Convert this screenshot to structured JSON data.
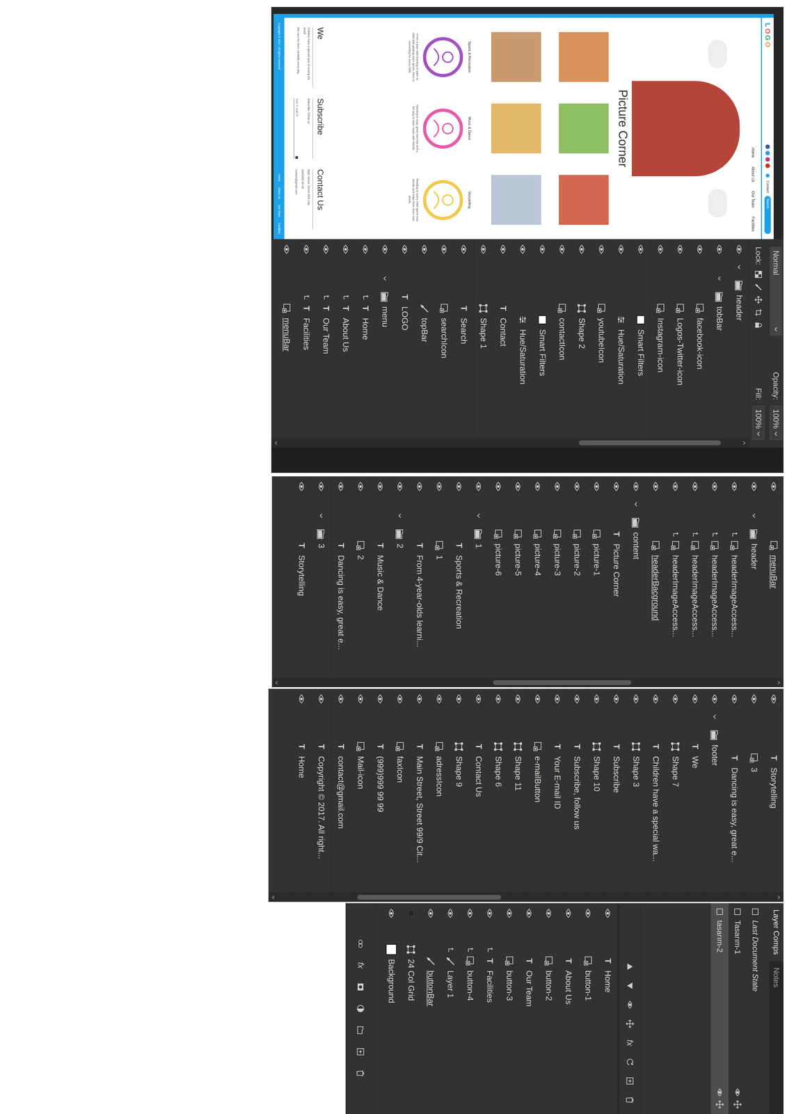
{
  "mockup": {
    "logo": [
      {
        "char": "L",
        "color": "#2d9cdb"
      },
      {
        "char": "O",
        "color": "#eb5757"
      },
      {
        "char": "G",
        "color": "#27ae60"
      },
      {
        "char": "O",
        "color": "#f2994a"
      }
    ],
    "contact": "Contact",
    "search": "Search",
    "nav": [
      "Home",
      "About Us",
      "Our Team",
      "Facilities"
    ],
    "title": "Picture Corner",
    "photos": [
      {
        "color": "#d9925a"
      },
      {
        "color": "#8fbf63"
      },
      {
        "color": "#d4674f"
      },
      {
        "color": "#c99a6e"
      },
      {
        "color": "#e3b868"
      },
      {
        "color": "#b9c7d6"
      }
    ],
    "features": [
      {
        "title": "Sports & Recreation",
        "text": "From 4-year-olds learning to swim to older kids playing team sports, there is something for every child.",
        "color": "#a24fc4"
      },
      {
        "title": "Music & Dance",
        "text": "Dancing is easy, great exercise and a fun way to learn music with friends.",
        "color": "#e85aa8"
      },
      {
        "title": "Storytelling",
        "text": "Reading to every child opens new worlds and helps them learn new words.",
        "color": "#f2c94c"
      }
    ],
    "columns": [
      {
        "title": "We",
        "lines": [
          "Children have a special way of seeing the world.",
          "We care for them carefully every day."
        ]
      },
      {
        "title": "Subscribe",
        "lines": [
          "Subscribe, follow us"
        ],
        "field": "Your E-mail ID"
      },
      {
        "title": "Contact Us",
        "lines": [
          "Main Street, Street 99/9 City",
          "(999)999 99 99",
          "contact@gmail.com"
        ]
      }
    ],
    "copyright": "Copyright © 2017. All rights reserved",
    "footer_nav": [
      "Home",
      "About Us",
      "Our Team",
      "Facilities"
    ]
  },
  "layers_panel": {
    "blend": "Normal",
    "opacity_label": "Opacity:",
    "opacity": "100%",
    "lock_label": "Lock:",
    "fill_label": "Fill:",
    "fill": "100%",
    "scroll": {
      "position": 0.04,
      "level": 0.31
    },
    "rows": [
      {
        "name": "header",
        "kind": "group",
        "depth": 0,
        "visible": true,
        "clipped": false,
        "underlined": false,
        "expanded": true
      },
      {
        "name": "tobBar",
        "kind": "group",
        "depth": 1,
        "visible": true,
        "clipped": false,
        "underlined": false,
        "expanded": true
      },
      {
        "name": "facebook-icon",
        "kind": "smart",
        "depth": 2,
        "visible": true,
        "clipped": false,
        "underlined": false
      },
      {
        "name": "Logos-Twitter-icon",
        "kind": "smart",
        "depth": 2,
        "visible": true,
        "clipped": false,
        "underlined": false
      },
      {
        "name": "Instagram-icon",
        "kind": "smart",
        "depth": 2,
        "visible": true,
        "clipped": false,
        "underlined": false
      },
      {
        "name": "Smart Filters",
        "kind": "filters",
        "depth": 3,
        "visible": true,
        "clipped": false,
        "underlined": false
      },
      {
        "name": "Hue/Saturation",
        "kind": "adjust",
        "depth": 3,
        "visible": true,
        "clipped": false,
        "underlined": false
      },
      {
        "name": "youtubeIcon",
        "kind": "smart",
        "depth": 2,
        "visible": true,
        "clipped": false,
        "underlined": false
      },
      {
        "name": "Shape 2",
        "kind": "shape",
        "depth": 2,
        "visible": true,
        "clipped": false,
        "underlined": false
      },
      {
        "name": "contactIcon",
        "kind": "smart",
        "depth": 2,
        "visible": true,
        "clipped": false,
        "underlined": false
      },
      {
        "name": "Smart Filters",
        "kind": "filters",
        "depth": 3,
        "visible": true,
        "clipped": false,
        "underlined": false
      },
      {
        "name": "Hue/Saturation",
        "kind": "adjust",
        "depth": 3,
        "visible": true,
        "clipped": false,
        "underlined": false
      },
      {
        "name": "Contact",
        "kind": "text",
        "glyph": "T",
        "depth": 2,
        "visible": true,
        "clipped": false,
        "underlined": false
      },
      {
        "name": "Shape 1",
        "kind": "shape",
        "depth": 2,
        "visible": true,
        "clipped": false,
        "underlined": false
      },
      {
        "name": "Search",
        "kind": "text",
        "glyph": "T",
        "depth": 2,
        "visible": true,
        "clipped": false,
        "underlined": false
      },
      {
        "name": "searchIcon",
        "kind": "smart",
        "depth": 2,
        "visible": true,
        "clipped": false,
        "underlined": false
      },
      {
        "name": "topBar",
        "kind": "brush",
        "depth": 2,
        "visible": true,
        "clipped": false,
        "underlined": false
      },
      {
        "name": "LOGO",
        "kind": "text",
        "glyph": "T",
        "depth": 1,
        "visible": true,
        "clipped": false,
        "underlined": false
      },
      {
        "name": "menu",
        "kind": "group",
        "depth": 1,
        "visible": true,
        "clipped": false,
        "underlined": false,
        "expanded": true
      },
      {
        "name": "Home",
        "kind": "text",
        "glyph": "T",
        "depth": 2,
        "visible": true,
        "clipped": true,
        "underlined": false
      },
      {
        "name": "About Us",
        "kind": "text",
        "glyph": "T",
        "depth": 2,
        "visible": true,
        "clipped": true,
        "underlined": false
      },
      {
        "name": "Our Team",
        "kind": "text",
        "glyph": "T",
        "depth": 2,
        "visible": true,
        "clipped": true,
        "underlined": false
      },
      {
        "name": "Facilities",
        "kind": "text",
        "glyph": "T",
        "depth": 2,
        "visible": true,
        "clipped": true,
        "underlined": false
      },
      {
        "name": "menuBar",
        "kind": "smart",
        "depth": 2,
        "visible": true,
        "clipped": false,
        "underlined": true
      }
    ]
  },
  "layers_panel_2": {
    "scroll": {
      "position": 0.29,
      "level": 0.28
    },
    "rows": [
      {
        "name": "menuBar",
        "kind": "smart",
        "depth": 2,
        "visible": true,
        "clipped": false,
        "underlined": true
      },
      {
        "name": "header",
        "kind": "group",
        "depth": 1,
        "visible": true,
        "clipped": false,
        "underlined": false,
        "expanded": true
      },
      {
        "name": "headerImageAccess...",
        "kind": "smart",
        "depth": 2,
        "visible": true,
        "clipped": true,
        "underlined": false
      },
      {
        "name": "headerImageAccess...",
        "kind": "smart",
        "depth": 2,
        "visible": true,
        "clipped": true,
        "underlined": false
      },
      {
        "name": "headerImageAccess...",
        "kind": "smart",
        "depth": 2,
        "visible": true,
        "clipped": true,
        "underlined": false
      },
      {
        "name": "headerImageAccess...",
        "kind": "smart",
        "depth": 2,
        "visible": true,
        "clipped": true,
        "underlined": false
      },
      {
        "name": "headerBacground",
        "kind": "smart",
        "depth": 2,
        "visible": true,
        "clipped": false,
        "underlined": true
      },
      {
        "name": "content",
        "kind": "group",
        "depth": 0,
        "visible": true,
        "clipped": false,
        "underlined": false,
        "expanded": true
      },
      {
        "name": "Picture Corner",
        "kind": "text",
        "glyph": "T",
        "depth": 1,
        "visible": true,
        "clipped": false,
        "underlined": false
      },
      {
        "name": "picture-1",
        "kind": "smart",
        "depth": 1,
        "visible": true,
        "clipped": false,
        "underlined": false
      },
      {
        "name": "picture-2",
        "kind": "smart",
        "depth": 1,
        "visible": true,
        "clipped": false,
        "underlined": false
      },
      {
        "name": "picture-3",
        "kind": "smart",
        "depth": 1,
        "visible": true,
        "clipped": false,
        "underlined": false
      },
      {
        "name": "picture-4",
        "kind": "smart",
        "depth": 1,
        "visible": true,
        "clipped": false,
        "underlined": false
      },
      {
        "name": "picture-5",
        "kind": "smart",
        "depth": 1,
        "visible": true,
        "clipped": false,
        "underlined": false
      },
      {
        "name": "picture-6",
        "kind": "smart",
        "depth": 1,
        "visible": true,
        "clipped": false,
        "underlined": false
      },
      {
        "name": "1",
        "kind": "group",
        "depth": 1,
        "visible": true,
        "clipped": false,
        "underlined": false,
        "expanded": true
      },
      {
        "name": "Sports & Recreation",
        "kind": "text",
        "glyph": "T",
        "depth": 2,
        "visible": true,
        "clipped": false,
        "underlined": false
      },
      {
        "name": "1",
        "kind": "smart",
        "depth": 2,
        "visible": true,
        "clipped": false,
        "underlined": false
      },
      {
        "name": "From 4-year-olds learni...",
        "kind": "text",
        "glyph": "T",
        "depth": 2,
        "visible": true,
        "clipped": false,
        "underlined": false
      },
      {
        "name": "2",
        "kind": "group",
        "depth": 1,
        "visible": true,
        "clipped": false,
        "underlined": false,
        "expanded": true
      },
      {
        "name": "Music & Dance",
        "kind": "text",
        "glyph": "T",
        "depth": 2,
        "visible": true,
        "clipped": false,
        "underlined": false
      },
      {
        "name": "2",
        "kind": "smart",
        "depth": 2,
        "visible": true,
        "clipped": false,
        "underlined": false
      },
      {
        "name": "Dancing is easy, great e...",
        "kind": "text",
        "glyph": "T",
        "depth": 2,
        "visible": true,
        "clipped": false,
        "underlined": false
      },
      {
        "name": "3",
        "kind": "group",
        "depth": 1,
        "visible": true,
        "clipped": false,
        "underlined": false,
        "expanded": true
      },
      {
        "name": "Storytelling",
        "kind": "text",
        "glyph": "T",
        "depth": 2,
        "visible": true,
        "clipped": false,
        "underlined": false
      }
    ]
  },
  "layers_panel_3": {
    "scroll": {
      "position": 0.55,
      "level": 0.29
    },
    "rows": [
      {
        "name": "Storytelling",
        "kind": "text",
        "glyph": "T",
        "depth": 2,
        "visible": true,
        "clipped": false,
        "underlined": false
      },
      {
        "name": "3",
        "kind": "smart",
        "depth": 2,
        "visible": true,
        "clipped": false,
        "underlined": false
      },
      {
        "name": "Dancing is easy, great e...",
        "kind": "text",
        "glyph": "T",
        "depth": 2,
        "visible": true,
        "clipped": false,
        "underlined": false
      },
      {
        "name": "footer",
        "kind": "group",
        "depth": 0,
        "visible": true,
        "clipped": false,
        "underlined": false,
        "expanded": true
      },
      {
        "name": "We",
        "kind": "text",
        "glyph": "T",
        "depth": 1,
        "visible": true,
        "clipped": false,
        "underlined": false
      },
      {
        "name": "Shape 7",
        "kind": "shape",
        "depth": 1,
        "visible": true,
        "clipped": false,
        "underlined": false
      },
      {
        "name": "Children have a special wa...",
        "kind": "text",
        "glyph": "T",
        "depth": 1,
        "visible": true,
        "clipped": false,
        "underlined": false
      },
      {
        "name": "Shape 3",
        "kind": "shape",
        "depth": 1,
        "visible": true,
        "clipped": false,
        "underlined": false
      },
      {
        "name": "Subscribe",
        "kind": "text",
        "glyph": "T",
        "depth": 1,
        "visible": true,
        "clipped": false,
        "underlined": false
      },
      {
        "name": "Shape 10",
        "kind": "shape",
        "depth": 1,
        "visible": true,
        "clipped": false,
        "underlined": false
      },
      {
        "name": "Subscribe, follow us",
        "kind": "text",
        "glyph": "T",
        "depth": 1,
        "visible": true,
        "clipped": false,
        "underlined": false
      },
      {
        "name": "Your E-mail ID",
        "kind": "text",
        "glyph": "T",
        "depth": 1,
        "visible": true,
        "clipped": false,
        "underlined": false
      },
      {
        "name": "e-mailButton",
        "kind": "smart",
        "depth": 1,
        "visible": true,
        "clipped": false,
        "underlined": false
      },
      {
        "name": "Shape 11",
        "kind": "shape",
        "depth": 1,
        "visible": true,
        "clipped": false,
        "underlined": false
      },
      {
        "name": "Shape 6",
        "kind": "shape",
        "depth": 1,
        "visible": true,
        "clipped": false,
        "underlined": false
      },
      {
        "name": "Contact Us",
        "kind": "text",
        "glyph": "T",
        "depth": 1,
        "visible": true,
        "clipped": false,
        "underlined": false
      },
      {
        "name": "Shape 9",
        "kind": "shape",
        "depth": 1,
        "visible": true,
        "clipped": false,
        "underlined": false
      },
      {
        "name": "adressIcon",
        "kind": "smart",
        "depth": 1,
        "visible": true,
        "clipped": false,
        "underlined": false
      },
      {
        "name": "Main Street, Street 99/9 Cit...",
        "kind": "text",
        "glyph": "T",
        "depth": 1,
        "visible": true,
        "clipped": false,
        "underlined": false
      },
      {
        "name": "faxIcon",
        "kind": "smart",
        "depth": 1,
        "visible": true,
        "clipped": false,
        "underlined": false
      },
      {
        "name": "(999)999 99 99",
        "kind": "text",
        "glyph": "T",
        "depth": 1,
        "visible": true,
        "clipped": false,
        "underlined": false
      },
      {
        "name": "Mail-icon",
        "kind": "smart",
        "depth": 1,
        "visible": true,
        "clipped": false,
        "underlined": false
      },
      {
        "name": "contact@gmail.com",
        "kind": "text",
        "glyph": "T",
        "depth": 1,
        "visible": true,
        "clipped": false,
        "underlined": false
      },
      {
        "name": "Copyright © 2017. All right...",
        "kind": "text",
        "glyph": "T",
        "depth": 1,
        "visible": true,
        "clipped": false,
        "underlined": false
      },
      {
        "name": "Home",
        "kind": "text",
        "glyph": "T",
        "depth": 1,
        "visible": true,
        "clipped": false,
        "underlined": false
      }
    ]
  },
  "layer_comps": {
    "tabs": [
      {
        "label": "Layer Comps",
        "selected": true
      },
      {
        "label": "Notes",
        "selected": false
      }
    ],
    "items": [
      {
        "name": "Last Document State",
        "kind": "state",
        "selected": false
      },
      {
        "name": "Tasarım-1",
        "kind": "comp",
        "selected": false
      },
      {
        "name": "tasarım-2",
        "kind": "comp",
        "selected": true
      }
    ],
    "toolbar": [
      {
        "kind": "up"
      },
      {
        "kind": "down"
      },
      {
        "kind": "visibility"
      },
      {
        "kind": "position"
      },
      {
        "kind": "fx",
        "glyph": "fx"
      },
      {
        "kind": "update"
      },
      {
        "kind": "new"
      },
      {
        "kind": "delete"
      }
    ]
  },
  "layers_panel_4": {
    "rows": [
      {
        "name": "Home",
        "kind": "text",
        "glyph": "T",
        "depth": 1,
        "visible": true,
        "clipped": false,
        "underlined": false
      },
      {
        "name": "button-1",
        "kind": "smart",
        "depth": 1,
        "visible": true,
        "clipped": false,
        "underlined": false
      },
      {
        "name": "About Us",
        "kind": "text",
        "glyph": "T",
        "depth": 1,
        "visible": true,
        "clipped": false,
        "underlined": false
      },
      {
        "name": "button-2",
        "kind": "smart",
        "depth": 1,
        "visible": true,
        "clipped": false,
        "underlined": false
      },
      {
        "name": "Our Team",
        "kind": "text",
        "glyph": "T",
        "depth": 1,
        "visible": true,
        "clipped": false,
        "underlined": false
      },
      {
        "name": "button-3",
        "kind": "smart",
        "depth": 1,
        "visible": true,
        "clipped": false,
        "underlined": false
      },
      {
        "name": "Facilities",
        "kind": "text",
        "glyph": "T",
        "depth": 1,
        "visible": true,
        "clipped": true,
        "underlined": false
      },
      {
        "name": "button-4",
        "kind": "smart",
        "depth": 1,
        "visible": true,
        "clipped": true,
        "underlined": false
      },
      {
        "name": "Layer 1",
        "kind": "brush",
        "depth": 1,
        "visible": true,
        "clipped": true,
        "underlined": false
      },
      {
        "name": "buttonBar",
        "kind": "brush",
        "depth": 1,
        "visible": true,
        "clipped": false,
        "underlined": true
      },
      {
        "name": "24 Col Grid",
        "kind": "shape",
        "depth": 0,
        "visible": false,
        "clipped": false,
        "underlined": false
      },
      {
        "name": "Background",
        "kind": "fill",
        "depth": 0,
        "visible": true,
        "clipped": false,
        "underlined": false
      }
    ],
    "toolbar": [
      {
        "kind": "link"
      },
      {
        "kind": "fx",
        "glyph": "fx"
      },
      {
        "kind": "mask"
      },
      {
        "kind": "adjust"
      },
      {
        "kind": "group"
      },
      {
        "kind": "new"
      },
      {
        "kind": "delete"
      }
    ]
  }
}
